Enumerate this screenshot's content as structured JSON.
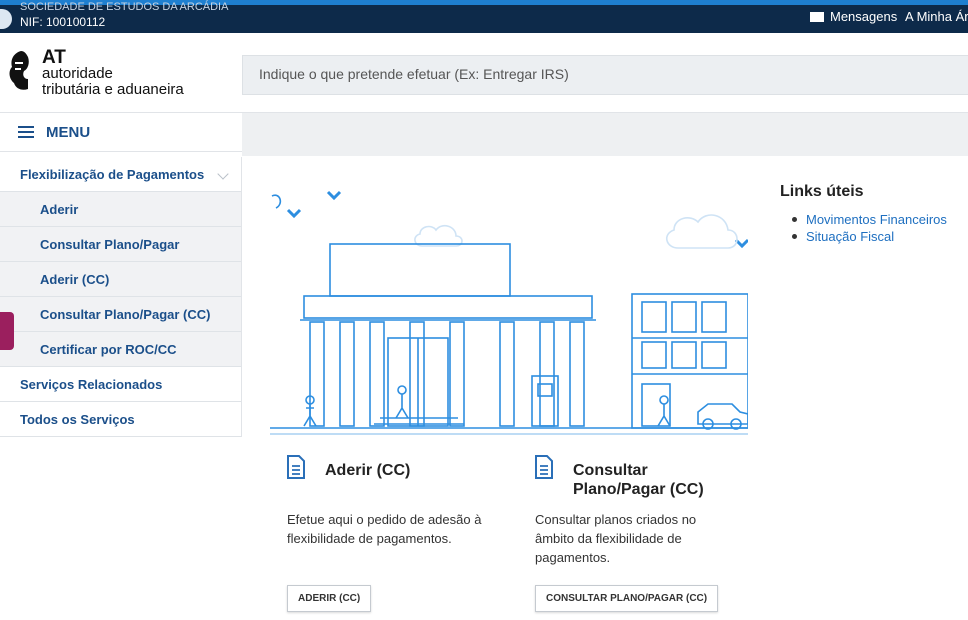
{
  "topbar": {
    "user_name": "SOCIEDADE DE ESTUDOS DA ARCÁDIA",
    "nif": "NIF: 100100112",
    "messages_label": "Mensagens",
    "account_label": "A Minha Área"
  },
  "header": {
    "logo_at": "AT",
    "logo_line1": "autoridade",
    "logo_line2": "tributária e aduaneira",
    "search_placeholder": "Indique o que pretende efetuar (Ex: Entregar IRS)"
  },
  "menu": {
    "label": "MENU"
  },
  "sidebar": {
    "items": [
      {
        "label": "Flexibilização de Pagamentos"
      },
      {
        "label": "Aderir"
      },
      {
        "label": "Consultar Plano/Pagar"
      },
      {
        "label": "Aderir (CC)"
      },
      {
        "label": "Consultar Plano/Pagar (CC)"
      },
      {
        "label": "Certificar por ROC/CC"
      },
      {
        "label": "Serviços Relacionados"
      },
      {
        "label": "Todos os Serviços"
      }
    ]
  },
  "cards": [
    {
      "title": "Aderir (CC)",
      "description": "Efetue aqui o pedido de adesão à flexibilidade de pagamentos.",
      "button": "ADERIR (CC)"
    },
    {
      "title": "Consultar Plano/Pagar (CC)",
      "description": "Consultar planos criados no âmbito da flexibilidade de pagamentos.",
      "button": "CONSULTAR PLANO/PAGAR (CC)"
    }
  ],
  "links": {
    "heading": "Links úteis",
    "items": [
      "Movimentos Financeiros",
      "Situação Fiscal"
    ]
  },
  "colors": {
    "topbar": "#0d2a4a",
    "accent": "#1e7fd0",
    "link": "#1b4f8a",
    "pink_tab": "#9b1f5e"
  }
}
